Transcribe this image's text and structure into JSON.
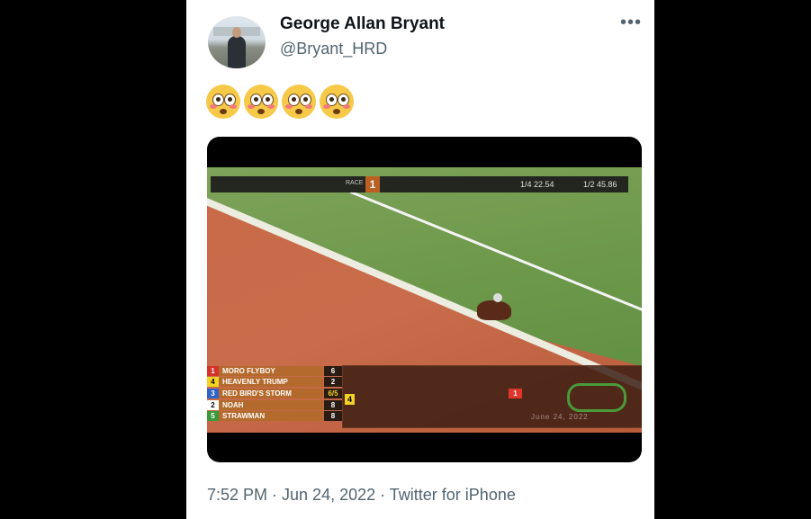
{
  "tweet": {
    "author_name": "George Allan Bryant",
    "handle": "@Bryant_HRD",
    "more_label": "•••",
    "emoji_count": 4,
    "timestamp": "7:52 PM · Jun 24, 2022 · Twitter for iPhone"
  },
  "video": {
    "race_label": "RACE",
    "race_number": "1",
    "quarter_time": "1/4 22.54",
    "half_time": "1/2 45.86",
    "running_order": [
      {
        "pp": "1",
        "name": "MORO FLYBOY",
        "odds": "6",
        "color": "#d6312a"
      },
      {
        "pp": "4",
        "name": "HEAVENLY TRUMP",
        "odds": "2",
        "color": "#f2d224"
      },
      {
        "pp": "3",
        "name": "RED BIRD'S STORM",
        "odds": "6/5",
        "color": "#2f63c8"
      },
      {
        "pp": "2",
        "name": "NOAH",
        "odds": "8",
        "color": "#ffffff"
      },
      {
        "pp": "5",
        "name": "STRAWMAN",
        "odds": "8",
        "color": "#3a9a3a"
      }
    ],
    "marker_number": "4",
    "leader_number": "1",
    "date_stamp": "June 24, 2022"
  }
}
